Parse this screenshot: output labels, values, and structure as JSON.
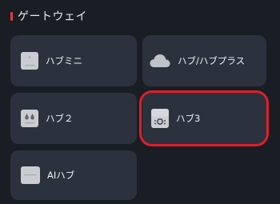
{
  "section": {
    "title": "ゲートウェイ"
  },
  "cards": [
    {
      "label": "ハブミニ",
      "icon": "hub-mini-icon"
    },
    {
      "label": "ハブ/ハブプラス",
      "icon": "cloud-icon"
    },
    {
      "label": "ハブ２",
      "icon": "hub-2-icon"
    },
    {
      "label": "ハブ3",
      "icon": "hub-3-icon"
    },
    {
      "label": "AIハブ",
      "icon": "ai-hub-icon"
    }
  ],
  "colors": {
    "background": "#191d24",
    "card": "#2c323d",
    "accent": "#e13a3a",
    "highlight": "#e11d2a",
    "text": "#f0f2f5"
  }
}
